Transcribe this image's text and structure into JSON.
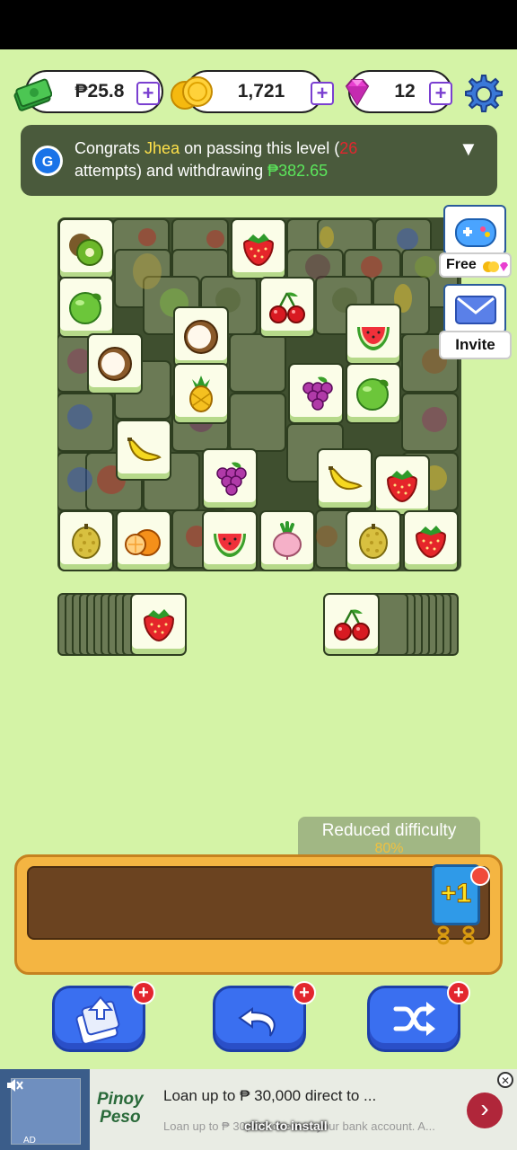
{
  "currency": {
    "cash": "₱25.8",
    "coins": "1,721",
    "gems": "12",
    "plus": "+"
  },
  "banner": {
    "prefix": "Congrats ",
    "name": "Jhea",
    "mid": " on passing this level (",
    "attempts": "26",
    "line2a": "attempts)  and withdrawing ",
    "amount": "₱382.65",
    "toggle": "▼"
  },
  "side": {
    "free_label": "Free",
    "invite_label": "Invite"
  },
  "difficulty": {
    "label": "Reduced difficulty",
    "value": "80%"
  },
  "booster": {
    "label": "+1"
  },
  "actions": {
    "add_badge": "+"
  },
  "ad": {
    "brand_line1": "Pinoy",
    "brand_line2": "Peso",
    "title": "Loan up to ₱ 30,000 direct to ...",
    "subtitle": "Loan up to ₱ 30,000 direct to your bank account. A...",
    "overlay": "click to install",
    "ad_tag": "AD",
    "close": "✕",
    "next": "›"
  },
  "tiles": [
    {
      "fruit": "kiwi",
      "dim": false
    },
    {
      "fruit": "strawberry",
      "dim": false
    },
    {
      "fruit": "lime",
      "dim": false
    },
    {
      "fruit": "cherry",
      "dim": false
    },
    {
      "fruit": "watermelon",
      "dim": false
    },
    {
      "fruit": "coconut",
      "dim": false
    },
    {
      "fruit": "coconut",
      "dim": false
    },
    {
      "fruit": "pineapple",
      "dim": false
    },
    {
      "fruit": "grape",
      "dim": false
    },
    {
      "fruit": "lime",
      "dim": false
    },
    {
      "fruit": "banana",
      "dim": false
    },
    {
      "fruit": "grape",
      "dim": false
    },
    {
      "fruit": "banana",
      "dim": false
    },
    {
      "fruit": "strawberry",
      "dim": false
    },
    {
      "fruit": "durian",
      "dim": false
    },
    {
      "fruit": "orange",
      "dim": false
    },
    {
      "fruit": "watermelon",
      "dim": false
    },
    {
      "fruit": "turnip",
      "dim": false
    },
    {
      "fruit": "durian",
      "dim": false
    },
    {
      "fruit": "strawberry",
      "dim": false
    },
    {
      "fruit": "strawberry",
      "dim": false
    },
    {
      "fruit": "cherry",
      "dim": false
    }
  ]
}
